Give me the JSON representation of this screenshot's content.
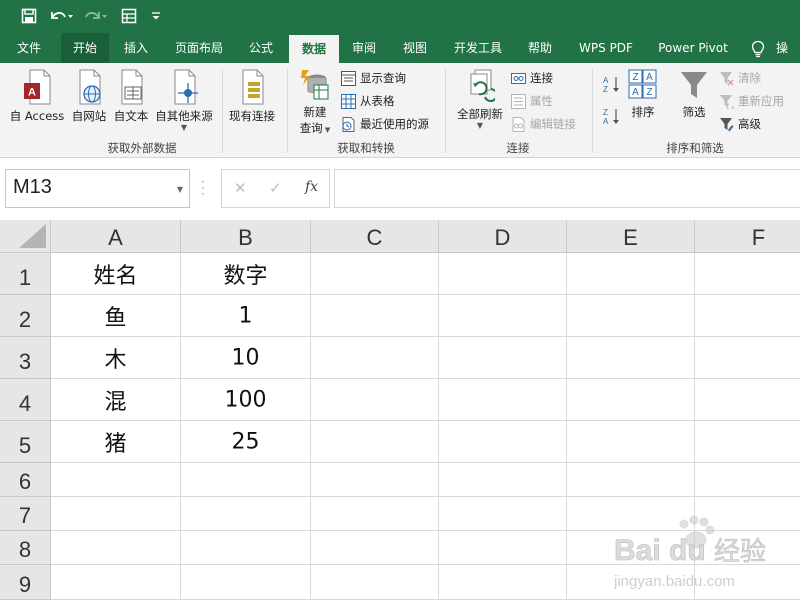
{
  "title_bar": {
    "icons": [
      "save-icon",
      "undo-icon",
      "redo-icon",
      "form-icon",
      "customize-quick-access-icon"
    ]
  },
  "ribbon_tabs": [
    "文件",
    "开始",
    "插入",
    "页面布局",
    "公式",
    "数据",
    "审阅",
    "视图",
    "开发工具",
    "帮助",
    "WPS PDF",
    "Power Pivot",
    "操"
  ],
  "active_tab": "数据",
  "lightbulb_icon": "lightbulb-icon",
  "ribbon": {
    "get_external": {
      "access": "自 Access",
      "web": "自网站",
      "text": "自文本",
      "other": "自其他来源",
      "existing": "现有连接",
      "group": "获取外部数据"
    },
    "get_transform": {
      "new_query_1": "新建",
      "new_query_2": "查询",
      "show_queries": "显示查询",
      "from_table": "从表格",
      "recent_sources": "最近使用的源",
      "group": "获取和转换"
    },
    "connections": {
      "refresh_all": "全部刷新",
      "connections": "连接",
      "properties": "属性",
      "edit_links": "编辑链接",
      "group": "连接"
    },
    "sort_filter": {
      "sort": "排序",
      "filter": "筛选",
      "clear": "清除",
      "reapply": "重新应用",
      "advanced": "高级",
      "group": "排序和筛选"
    }
  },
  "formula_bar": {
    "name_box": "M13",
    "cancel": "✕",
    "enter": "✓",
    "fx": "fx",
    "formula": ""
  },
  "grid": {
    "columns": [
      "A",
      "B",
      "C",
      "D",
      "E",
      "F"
    ],
    "rows": [
      "1",
      "2",
      "3",
      "4",
      "5",
      "6",
      "7",
      "8",
      "9"
    ],
    "cells": [
      [
        "姓名",
        "数字"
      ],
      [
        "鱼",
        "1"
      ],
      [
        "木",
        "10"
      ],
      [
        "混",
        "100"
      ],
      [
        "猪",
        "25"
      ]
    ]
  },
  "watermark": {
    "brand": "Bai",
    "brand2": "经验",
    "url": "jingyan.baidu.com"
  },
  "colors": {
    "excel_green": "#217346",
    "ribbon_bg": "#f3f3f3",
    "header_bg": "#e6e6e6"
  }
}
